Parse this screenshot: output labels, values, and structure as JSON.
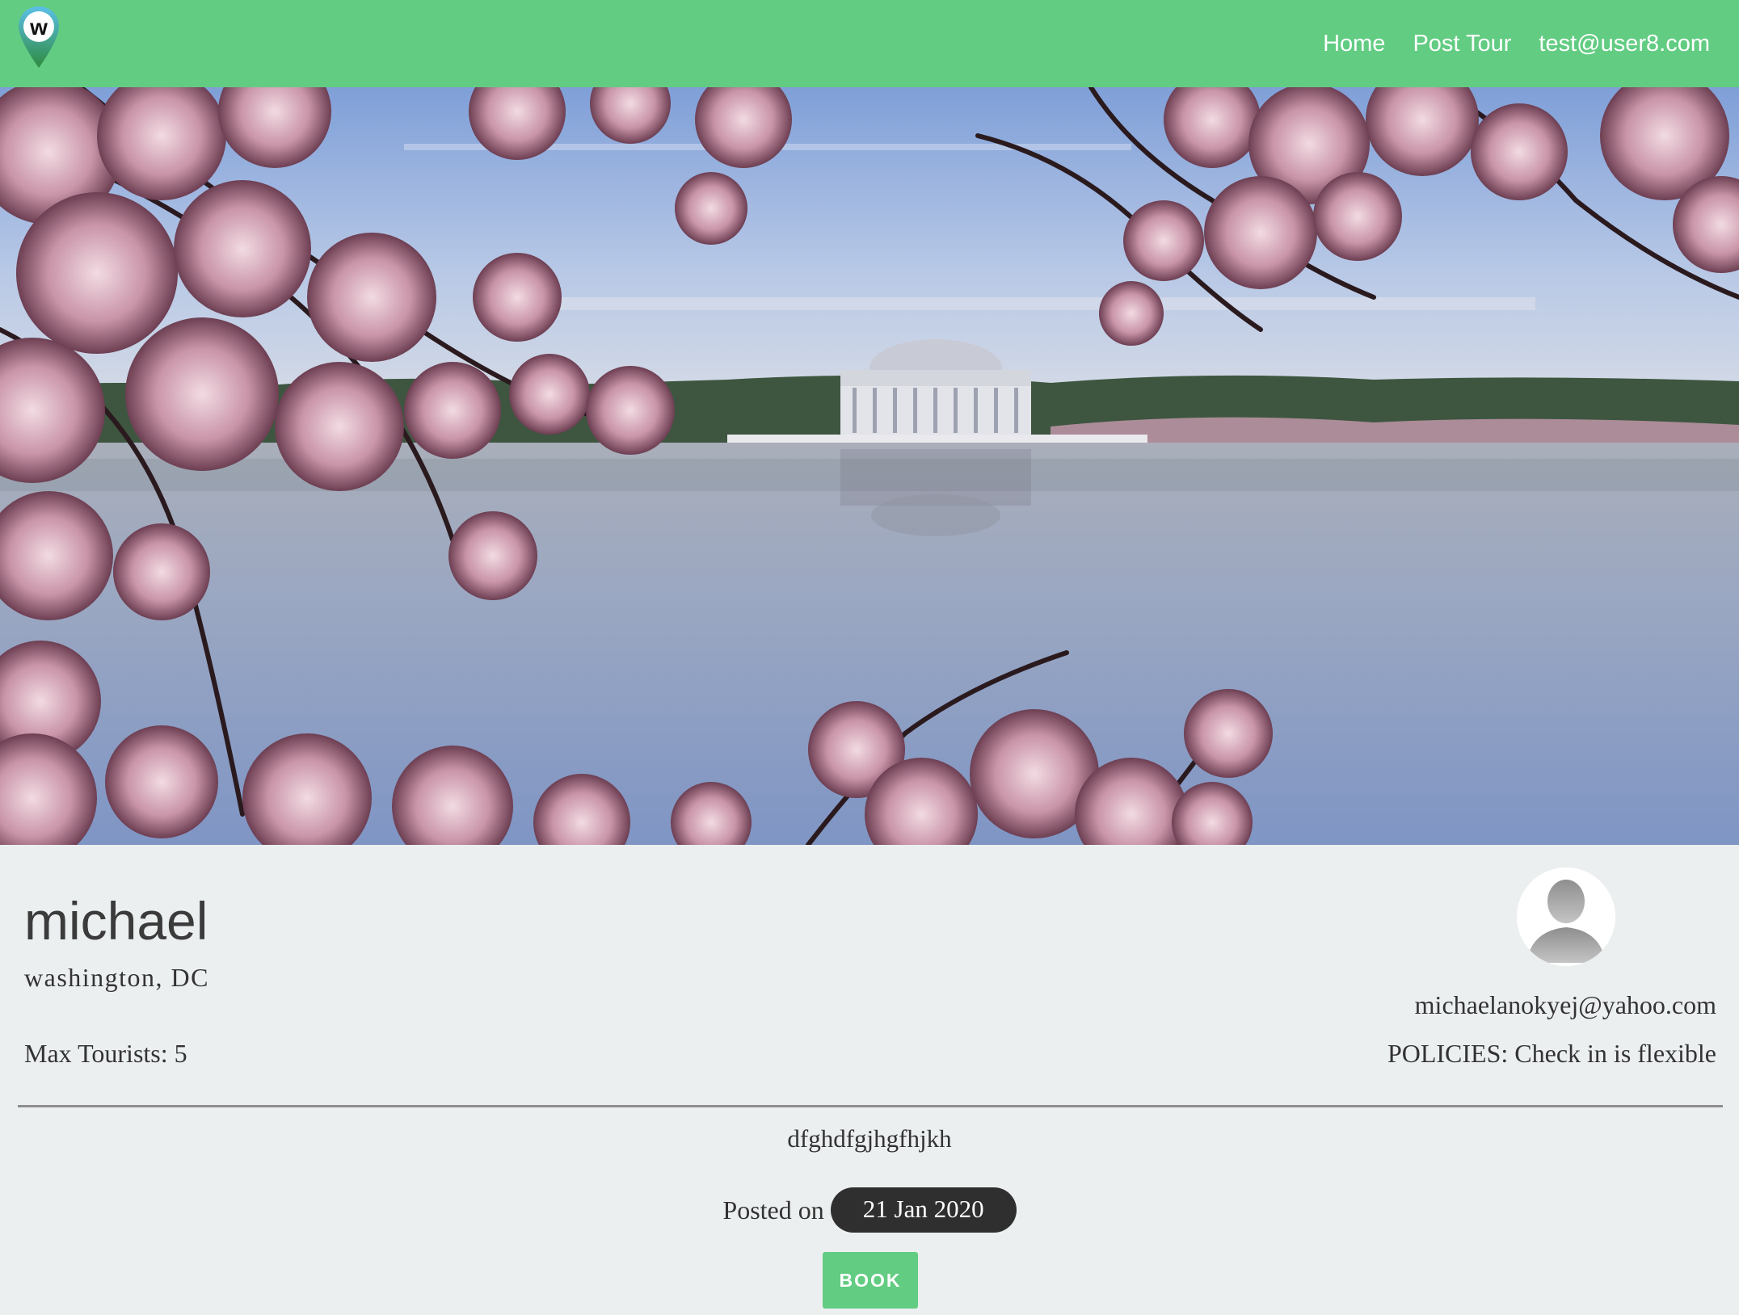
{
  "nav": {
    "logo_letter": "w",
    "links": [
      "Home",
      "Post Tour",
      "test@user8.com"
    ]
  },
  "tour": {
    "title": "michael",
    "location": "washington, DC",
    "max_tourists": "Max Tourists: 5",
    "host_email": "michaelanokyej@yahoo.com",
    "policies": "POLICIES: Check in is flexible",
    "description": "dfghdfgjhgfhjkh",
    "posted_label": "Posted on",
    "posted_date": "21 Jan 2020",
    "book_label": "BOOK"
  },
  "colors": {
    "brand_green": "#62cc82",
    "page_bg": "#eceff0",
    "badge_bg": "#2f2f2f"
  }
}
